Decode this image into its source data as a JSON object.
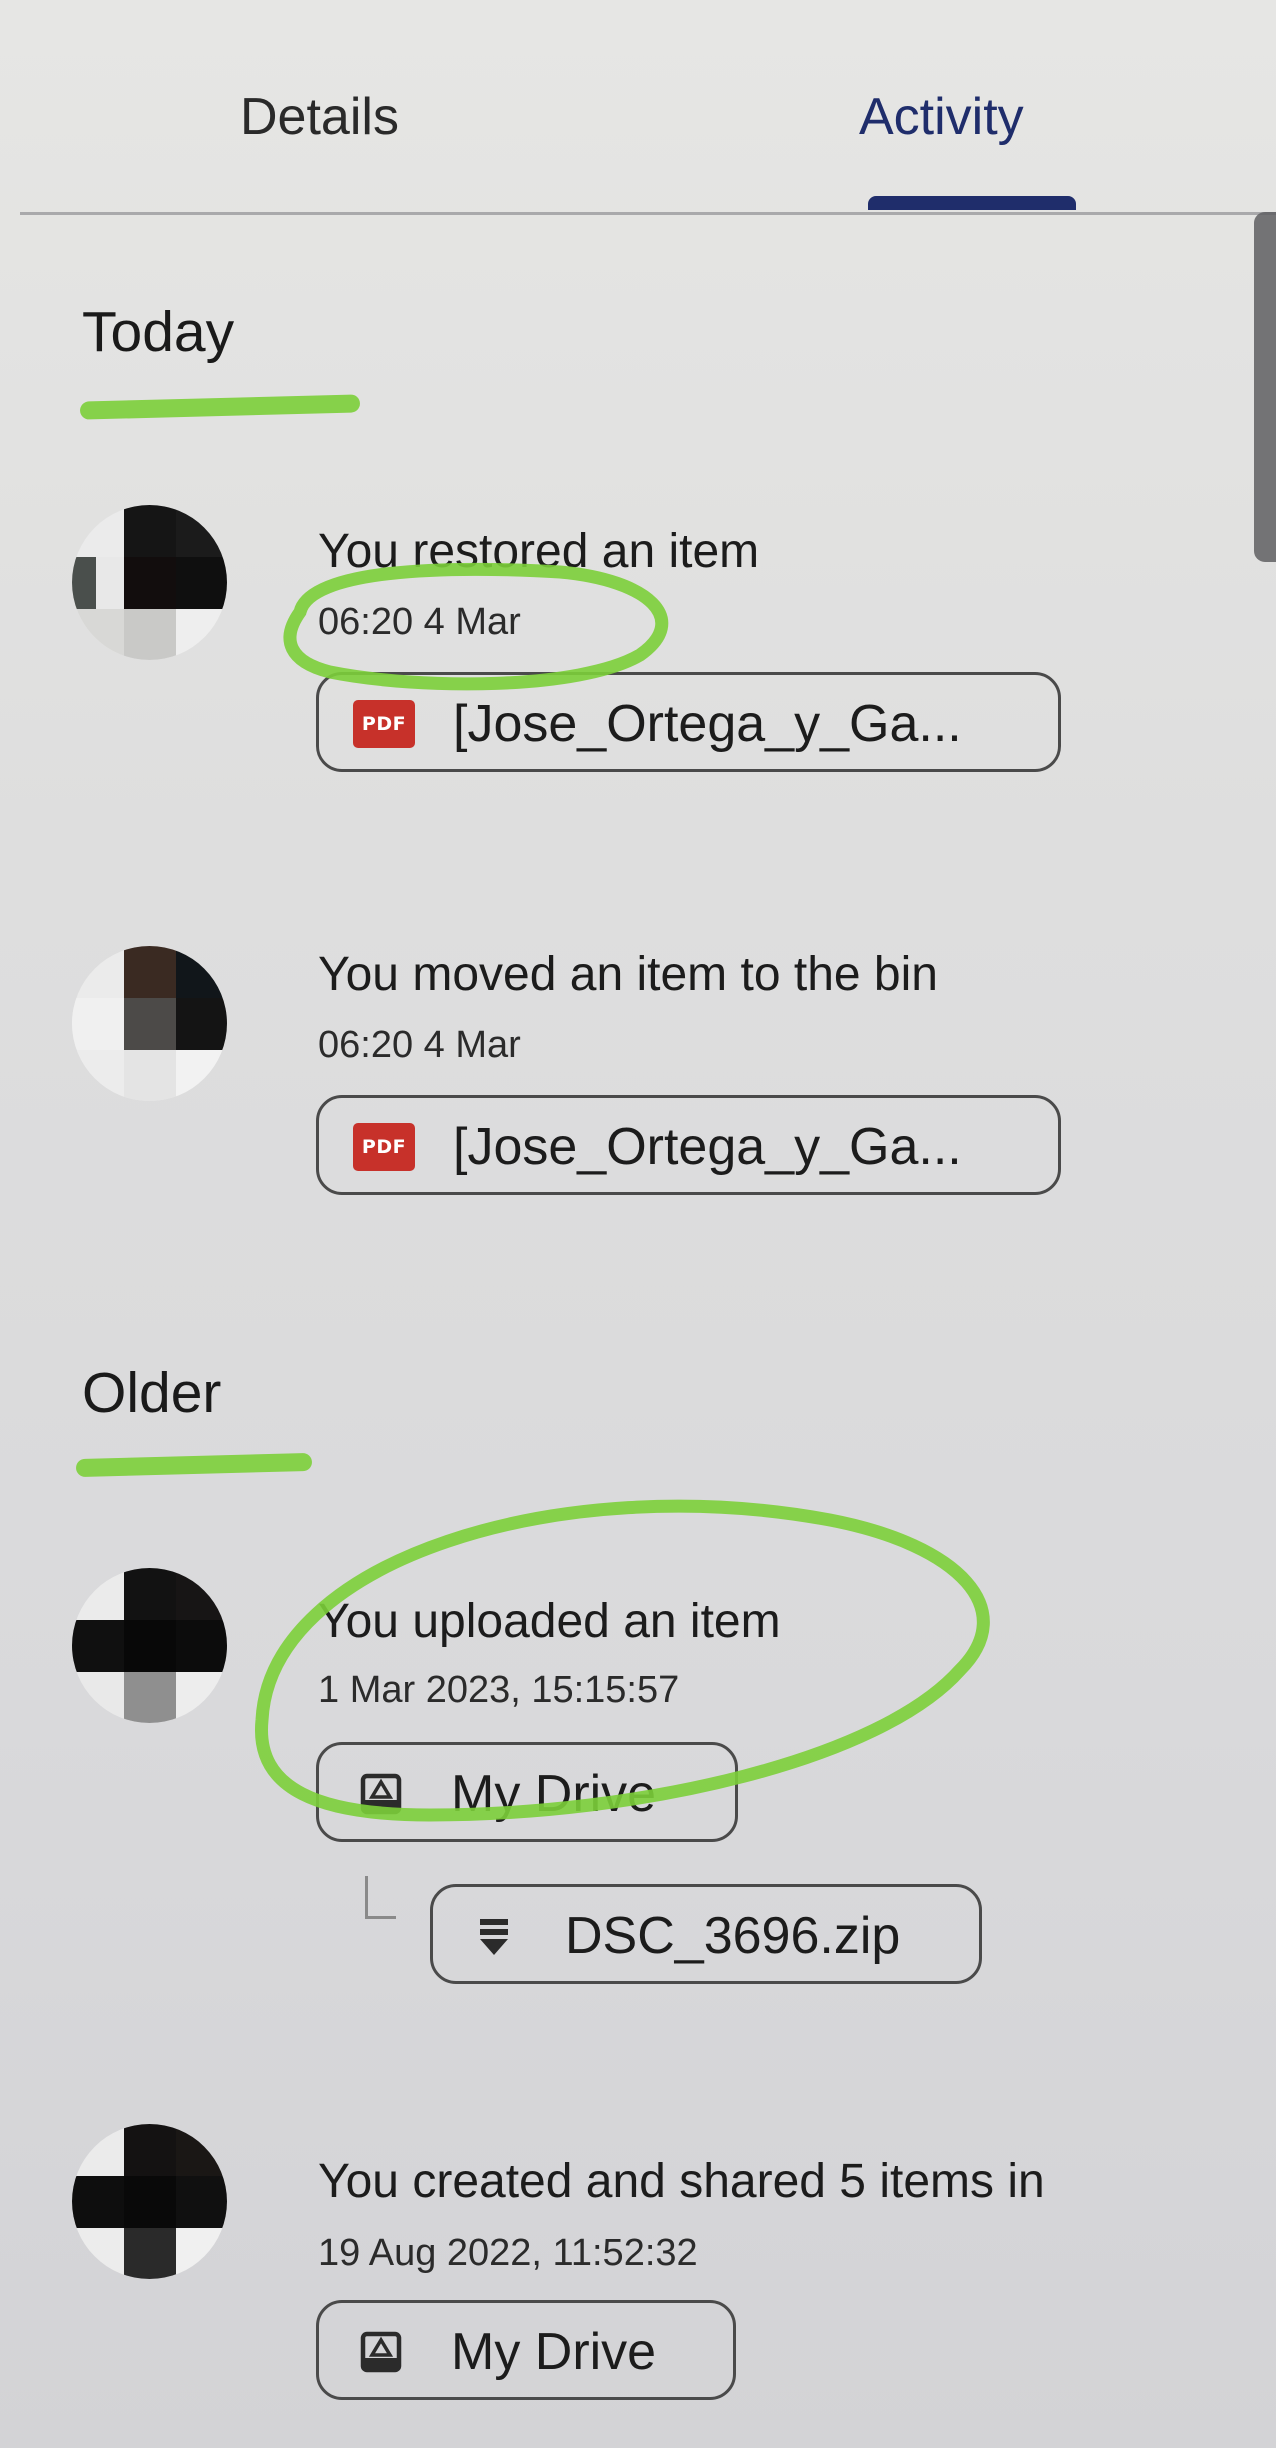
{
  "tabs": [
    {
      "label": "Details",
      "active": false
    },
    {
      "label": "Activity",
      "active": true
    }
  ],
  "colors": {
    "accent": "#1f2d6b",
    "pdf_badge": "#c7312a",
    "annotation_marker": "#7ccf3a"
  },
  "sections": {
    "today": {
      "heading": "Today",
      "entries": [
        {
          "title": "You restored an item",
          "time": "06:20 4 Mar",
          "chip": {
            "icon": "pdf-icon",
            "icon_text": "PDF",
            "label": "[Jose_Ortega_y_Ga..."
          }
        },
        {
          "title": "You moved an item to the bin",
          "time": "06:20 4 Mar",
          "chip": {
            "icon": "pdf-icon",
            "icon_text": "PDF",
            "label": "[Jose_Ortega_y_Ga..."
          }
        }
      ]
    },
    "older": {
      "heading": "Older",
      "entries": [
        {
          "title": "You uploaded an item",
          "time": "1 Mar 2023, 15:15:57",
          "chip": {
            "icon": "drive-folder-icon",
            "label": "My Drive"
          },
          "child_chip": {
            "icon": "zip-file-icon",
            "label": "DSC_3696.zip"
          }
        },
        {
          "title": "You created and shared 5 items in",
          "time": "19 Aug 2022, 11:52:32",
          "chip": {
            "icon": "drive-folder-icon",
            "label": "My Drive"
          }
        }
      ]
    }
  }
}
